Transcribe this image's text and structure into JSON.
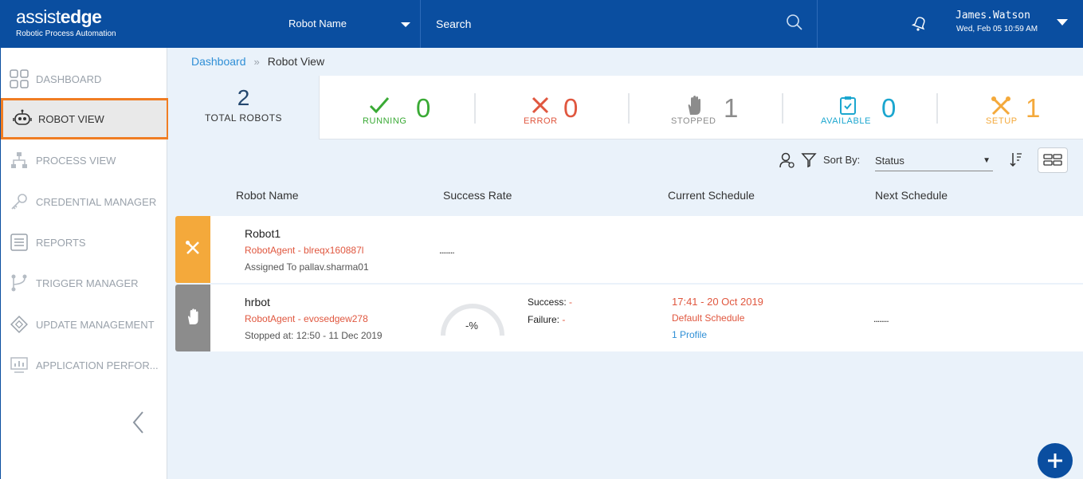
{
  "header": {
    "logo_text_light": "assist",
    "logo_text_bold": "edge",
    "logo_subtitle": "Robotic Process Automation",
    "robot_select_label": "Robot Name",
    "search_label": "Search",
    "user_name": "James.Watson",
    "user_time": "Wed, Feb 05 10:59 AM"
  },
  "sidebar": {
    "items": [
      {
        "label": "DASHBOARD",
        "icon": "grid-icon"
      },
      {
        "label": "ROBOT VIEW",
        "icon": "robot-icon",
        "active": true
      },
      {
        "label": "PROCESS VIEW",
        "icon": "hierarchy-icon"
      },
      {
        "label": "CREDENTIAL MANAGER",
        "icon": "key-icon"
      },
      {
        "label": "REPORTS",
        "icon": "list-icon"
      },
      {
        "label": "TRIGGER MANAGER",
        "icon": "branch-icon"
      },
      {
        "label": "UPDATE MANAGEMENT",
        "icon": "chip-icon"
      },
      {
        "label": "APPLICATION PERFOR...",
        "icon": "monitor-chart-icon"
      }
    ]
  },
  "breadcrumb": {
    "root": "Dashboard",
    "current": "Robot View"
  },
  "stats": {
    "total": {
      "value": "2",
      "label": "TOTAL ROBOTS"
    },
    "running": {
      "value": "0",
      "label": "RUNNING",
      "color": "#3aaa35"
    },
    "error": {
      "value": "0",
      "label": "ERROR",
      "color": "#e0573f"
    },
    "stopped": {
      "value": "1",
      "label": "STOPPED",
      "color": "#8c8c8c"
    },
    "available": {
      "value": "0",
      "label": "AVAILABLE",
      "color": "#1ba6cf"
    },
    "setup": {
      "value": "1",
      "label": "SETUP",
      "color": "#f4a93b"
    }
  },
  "toolbar": {
    "sort_by_label": "Sort By:",
    "sort_value": "Status"
  },
  "table": {
    "columns": [
      "Robot Name",
      "Success Rate",
      "Current Schedule",
      "Next Schedule"
    ],
    "rows": [
      {
        "name": "Robot1",
        "agent": "RobotAgent - blreqx160887l",
        "sub": "Assigned To pallav.sharma01",
        "success_rate": "........",
        "status_color": "#f4a93b"
      },
      {
        "name": "hrbot",
        "agent": "RobotAgent - evosedgew278",
        "sub": "Stopped at: 12:50 - 11 Dec 2019",
        "gauge_text": "-%",
        "success_label": "Success:",
        "success_value": "-",
        "failure_label": "Failure:",
        "failure_value": "-",
        "schedule_time": "17:41 - 20 Oct 2019",
        "schedule_name": "Default Schedule",
        "schedule_profile": "1 Profile",
        "next_schedule": "........",
        "status_color": "#8c8c8c"
      }
    ]
  },
  "colors": {
    "brand": "#0a4ea0",
    "active_outline": "#f07d23",
    "link": "#2f8fd6"
  }
}
